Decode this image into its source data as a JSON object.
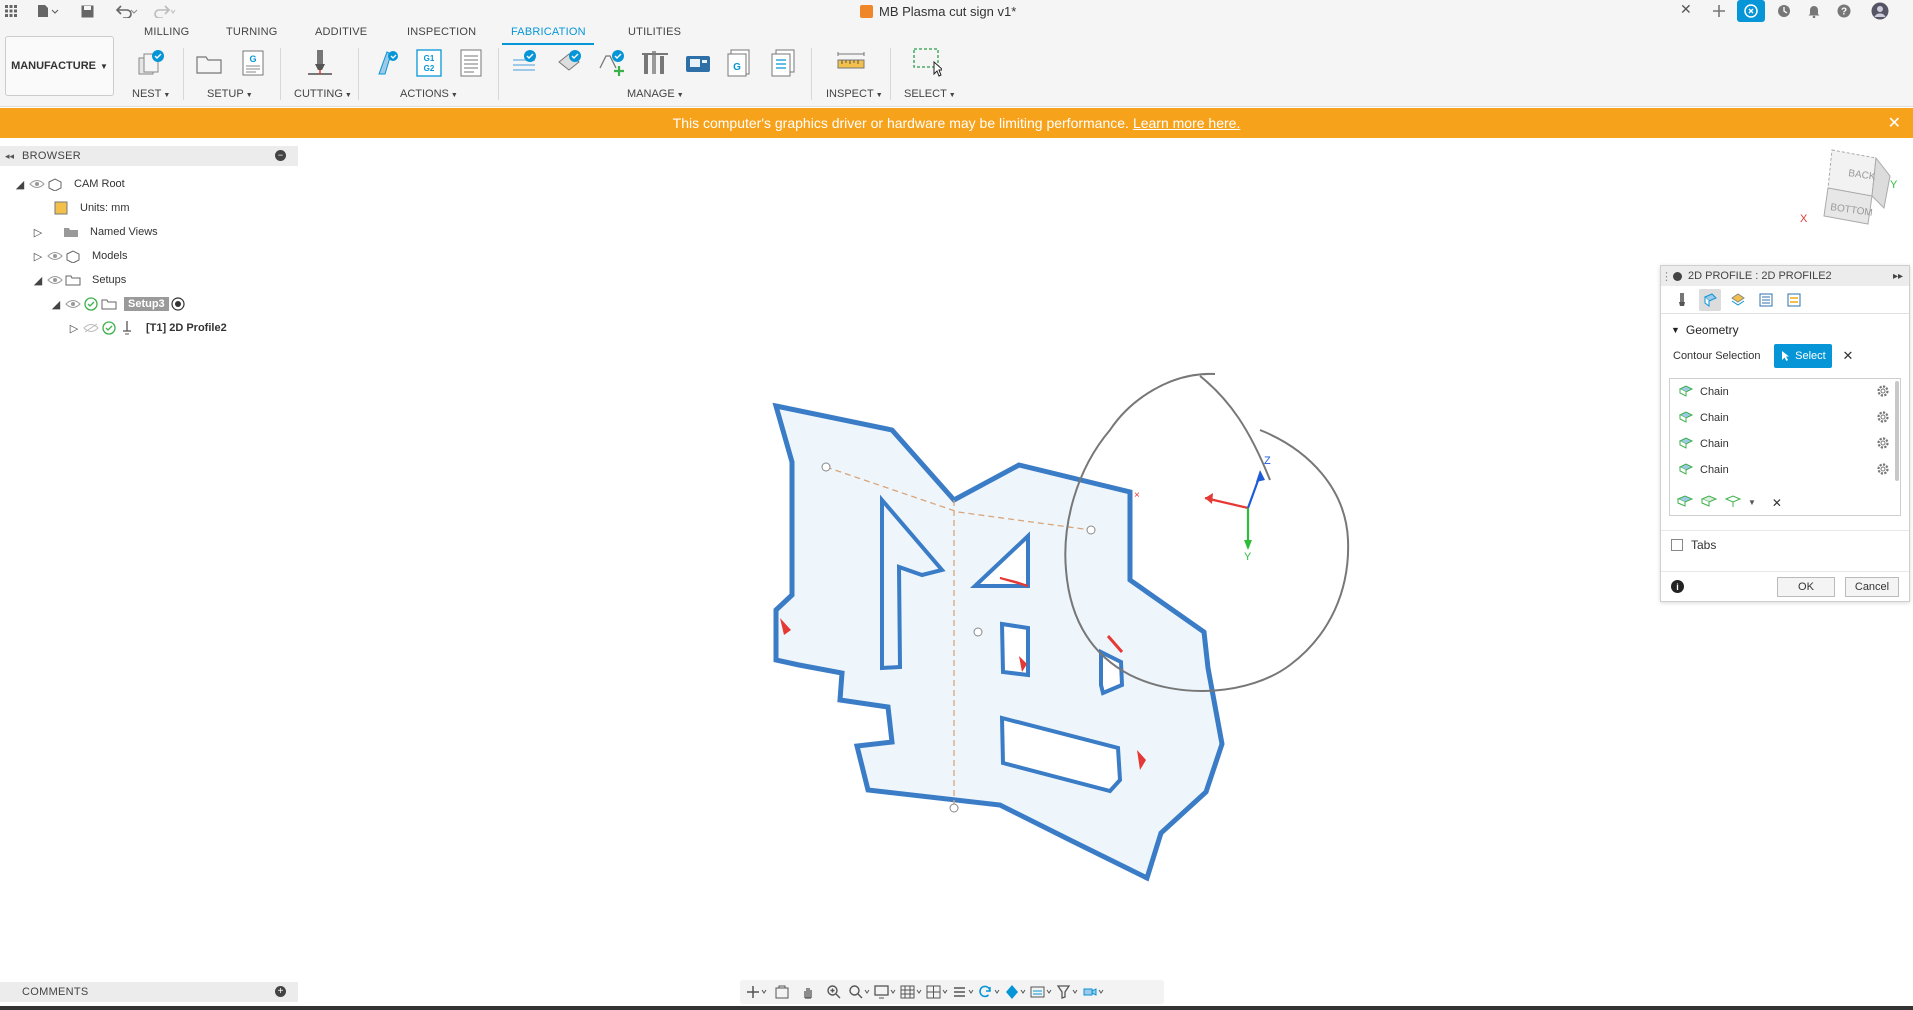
{
  "document": {
    "title": "MB Plasma cut sign v1*"
  },
  "ribbon": {
    "tabs": [
      "MILLING",
      "TURNING",
      "ADDITIVE",
      "INSPECTION",
      "FABRICATION",
      "UTILITIES"
    ],
    "active_tab": "FABRICATION",
    "workspace": "MANUFACTURE",
    "groups": {
      "nest": "NEST",
      "setup": "SETUP",
      "cutting": "CUTTING",
      "actions": "ACTIONS",
      "manage": "MANAGE",
      "inspect": "INSPECT",
      "select": "SELECT"
    }
  },
  "banner": {
    "message": "This computer's graphics driver or hardware may be limiting performance.",
    "link": "Learn more here."
  },
  "browser": {
    "title": "BROWSER",
    "items": {
      "root": "CAM Root",
      "units": "Units: mm",
      "named_views": "Named Views",
      "models": "Models",
      "setups": "Setups",
      "setup3": "Setup3",
      "operation": "[T1] 2D Profile2"
    }
  },
  "viewcube": {
    "top": "BACK",
    "face": "BOTTOM",
    "x_axis": "X",
    "y_axis": "Y"
  },
  "triad": {
    "z": "Z",
    "y": "Y"
  },
  "profile_panel": {
    "title": "2D PROFILE : 2D PROFILE2",
    "geometry_section": "Geometry",
    "contour_label": "Contour Selection",
    "select_button": "Select",
    "chains": [
      "Chain",
      "Chain",
      "Chain",
      "Chain"
    ],
    "tabs_label": "Tabs",
    "ok": "OK",
    "cancel": "Cancel"
  },
  "comments": {
    "title": "COMMENTS"
  },
  "colors": {
    "accent": "#0696d7",
    "warning": "#f7a21b",
    "part_fill": "#eef6fc",
    "part_stroke": "#3a7cc6",
    "marker": "#e53935"
  }
}
